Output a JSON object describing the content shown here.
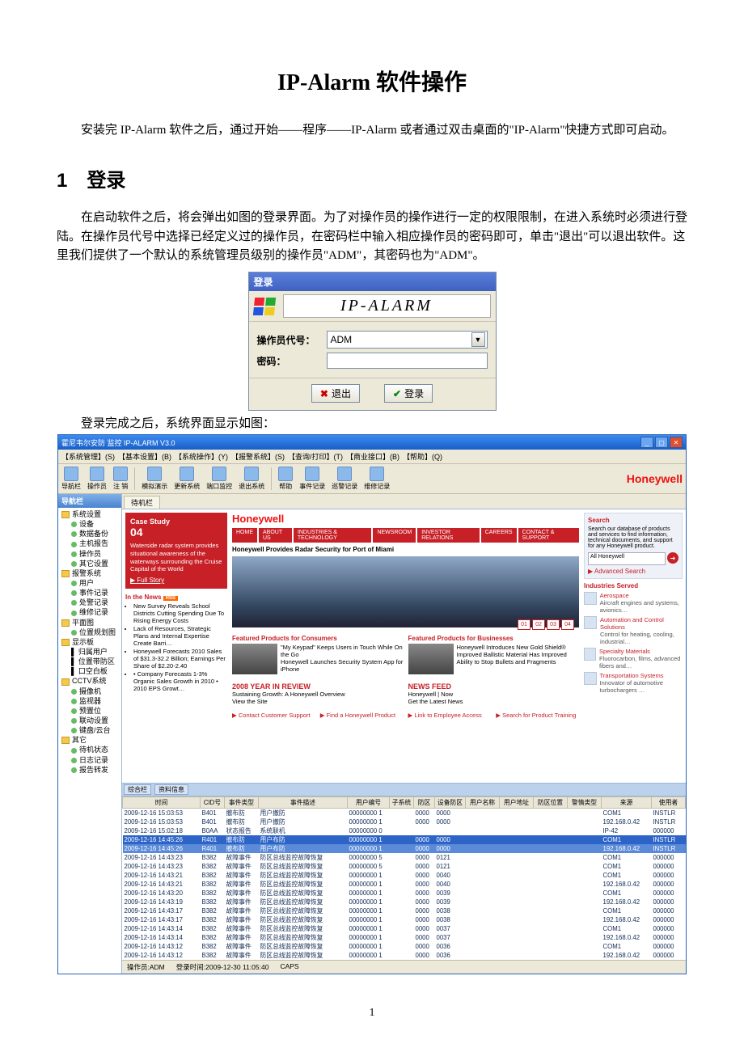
{
  "doc": {
    "title": "IP-Alarm 软件操作",
    "intro": "安装完 IP-Alarm 软件之后，通过开始——程序——IP-Alarm 或者通过双击桌面的\"IP-Alarm\"快捷方式即可启动。",
    "section1_heading": "1　登录",
    "section1_body": "在启动软件之后，将会弹出如图的登录界面。为了对操作员的操作进行一定的权限限制，在进入系统时必须进行登陆。在操作员代号中选择已经定义过的操作员，在密码栏中输入相应操作员的密码即可，单击\"退出\"可以退出软件。这里我们提供了一个默认的系统管理员级别的操作员\"ADM\"，其密码也为\"ADM\"。",
    "caption_after_login": "登录完成之后，系统界面显示如图：",
    "page_number": "1"
  },
  "login": {
    "title": "登录",
    "brand": "IP-ALARM",
    "operator_label": "操作员代号：",
    "operator_value": "ADM",
    "password_label": "密码：",
    "exit_btn": "退出",
    "login_btn": "登录"
  },
  "app": {
    "title": "霍尼韦尔安防 监控  IP-ALARM V3.0",
    "menus": [
      "【系统管理】(S)",
      "【基本设置】(B)",
      "【系统操作】(Y)",
      "【报警系统】(S)",
      "【查询/打印】(T)",
      "【商业接口】(B)",
      "【帮助】(Q)"
    ],
    "toolbar": [
      "导航栏",
      "操作员",
      "注 销",
      "模拟演示",
      "更新系统",
      "端口监控",
      "退出系统",
      "帮助",
      "事件记录",
      "巡警记录",
      "维修记录"
    ],
    "brand": "Honeywell",
    "side_title": "导航栏",
    "tree": [
      {
        "d": 0,
        "cls": "open ico-y",
        "t": "系统设置"
      },
      {
        "d": 1,
        "cls": "ico-g",
        "t": "设备"
      },
      {
        "d": 1,
        "cls": "ico-g",
        "t": "数据备份"
      },
      {
        "d": 1,
        "cls": "ico-g",
        "t": "主机报告"
      },
      {
        "d": 1,
        "cls": "ico-g",
        "t": "操作员"
      },
      {
        "d": 1,
        "cls": "ico-g",
        "t": "其它设置"
      },
      {
        "d": 0,
        "cls": "open ico-y",
        "t": "报警系统"
      },
      {
        "d": 1,
        "cls": "ico-g",
        "t": "用户"
      },
      {
        "d": 1,
        "cls": "ico-g",
        "t": "事件记录"
      },
      {
        "d": 1,
        "cls": "ico-g",
        "t": "处警记录"
      },
      {
        "d": 1,
        "cls": "ico-g",
        "t": "维修记录"
      },
      {
        "d": 0,
        "cls": "open ico-y",
        "t": "平面图"
      },
      {
        "d": 1,
        "cls": "ico-g",
        "t": "位置规划图"
      },
      {
        "d": 0,
        "cls": "open ico-y",
        "t": "显示板"
      },
      {
        "d": 1,
        "cls": "",
        "t": "▌ 归属用户"
      },
      {
        "d": 1,
        "cls": "",
        "t": "▌ 位置带防区"
      },
      {
        "d": 1,
        "cls": "",
        "t": "▌ 口空白板"
      },
      {
        "d": 0,
        "cls": "open ico-y",
        "t": "CCTV系统"
      },
      {
        "d": 1,
        "cls": "ico-g",
        "t": "摄像机"
      },
      {
        "d": 1,
        "cls": "ico-g",
        "t": "监视器"
      },
      {
        "d": 1,
        "cls": "ico-g",
        "t": "预置位"
      },
      {
        "d": 1,
        "cls": "ico-g",
        "t": "联动设置"
      },
      {
        "d": 1,
        "cls": "ico-g",
        "t": "键盘/云台"
      },
      {
        "d": 0,
        "cls": "open ico-y",
        "t": "其它"
      },
      {
        "d": 1,
        "cls": "ico-g",
        "t": "待机状态"
      },
      {
        "d": 1,
        "cls": "ico-g",
        "t": "日志记录"
      },
      {
        "d": 1,
        "cls": "ico-g",
        "t": "报告转发"
      }
    ],
    "tab_label": "待机栏",
    "web": {
      "brand": "Honeywell",
      "nav": [
        "HOME",
        "ABOUT US",
        "INDUSTRIES & TECHNOLOGY",
        "NEWSROOM",
        "INVESTOR RELATIONS",
        "CAREERS",
        "CONTACT & SUPPORT"
      ],
      "case_title": "Case Study",
      "case_no": "04",
      "case_body": "Waterside radar system provides situational awareness of the waterways surrounding the Cruise Capital of the World",
      "case_link": "▶ Full Story",
      "hero_head": "Honeywell Provides Radar Security for Port of Miami",
      "pager": [
        "01",
        "02",
        "03",
        "04"
      ],
      "in_news": "In the News",
      "rss": "RSS",
      "news_items": [
        "New Survey Reveals School Districts Cutting Spending Due To Rising Energy Costs",
        "Lack of Resources, Strategic Plans and Internal Expertise Create Barri…",
        "Honeywell Forecasts 2010 Sales of $31.3-32.2 Billion; Earnings Per Share of $2.20-2.40",
        "• Company Forecasts 1-3% Organic Sales Growth in 2010 • 2010 EPS Growt…"
      ],
      "feat_cons": "Featured Products for Consumers",
      "cons_items": [
        "\"My Keypad\" Keeps Users in Touch While On the Go",
        "Honeywell Launches Security System App for iPhone"
      ],
      "feat_biz": "Featured Products for Businesses",
      "biz_items": [
        "Honeywell Introduces New Gold Shield®",
        "Improved Ballistic Material Has Improved Ability to Stop Bullets and Fragments"
      ],
      "yr": "2008 YEAR IN REVIEW",
      "yr_items": [
        "Sustaining Growth: A Honeywell Overview",
        "View the Site"
      ],
      "feed": "NEWS FEED",
      "feed_items": [
        "Honeywell | Now",
        "Get the Latest News"
      ],
      "links": [
        "▶ Contact Customer Support",
        "▶ Find a Honeywell Product",
        "▶ Link to Employee Access",
        "▶ Search for Product Training"
      ],
      "search_h": "Search",
      "search_body": "Search our database of products and services to find information, technical documents, and support for any Honeywell product.",
      "search_field": "All Honeywell",
      "adv": "▶ Advanced Search",
      "ind_h": "Industries Served",
      "ind": [
        {
          "n": "Aerospace",
          "d": "Aircraft engines and systems, avionics…"
        },
        {
          "n": "Automation and Control Solutions",
          "d": "Control for heating, cooling, industrial…"
        },
        {
          "n": "Specialty Materials",
          "d": "Fluorocarbon, films, advanced fibers and…"
        },
        {
          "n": "Transportation Systems",
          "d": "Innovator of automotive turbochargers …"
        }
      ]
    },
    "bottom_tabs": [
      "综合栏",
      "资料信息"
    ],
    "grid": {
      "headers": [
        "时间",
        "CID号",
        "事件类型",
        "事件描述",
        "用户编号",
        "子系统",
        "防区",
        "设备防区",
        "用户名称",
        "用户地址",
        "防区位置",
        "警情类型",
        "来源",
        "使用者"
      ],
      "widths": [
        96,
        30,
        42,
        110,
        52,
        30,
        26,
        38,
        42,
        42,
        42,
        42,
        62,
        42
      ],
      "rows": [
        [
          "2009-12-16 15:03:53",
          "B401",
          "撤布防",
          "用户撤防",
          "00000000 1",
          "",
          "0000",
          "0000",
          "",
          "",
          "",
          "",
          "COM1",
          "INSTLR"
        ],
        [
          "2009-12-16 15:03:53",
          "B401",
          "撤布防",
          "用户撤防",
          "00000000 1",
          "",
          "0000",
          "0000",
          "",
          "",
          "",
          "",
          "192.168.0.42",
          "INSTLR"
        ],
        [
          "2009-12-16 15:02:18",
          "B0AA",
          "状态报告",
          "系统联机",
          "00000000 0",
          "",
          "",
          "",
          "",
          "",
          "",
          "",
          "IP-42",
          "000000"
        ],
        [
          "2009-12-16 14:45:26",
          "R401",
          "撤布防",
          "用户布防",
          "00000000 1",
          "",
          "0000",
          "0000",
          "",
          "",
          "",
          "",
          "COM1",
          "INSTLR"
        ],
        [
          "2009-12-16 14:45:26",
          "R401",
          "撤布防",
          "用户布防",
          "00000000 1",
          "",
          "0000",
          "0000",
          "",
          "",
          "",
          "",
          "192.168.0.42",
          "INSTLR"
        ],
        [
          "2009-12-16 14:43:23",
          "B382",
          "故障事件",
          "防区总线监控故障恢复",
          "00000000 5",
          "",
          "0000",
          "0121",
          "",
          "",
          "",
          "",
          "COM1",
          "000000"
        ],
        [
          "2009-12-16 14:43:23",
          "B382",
          "故障事件",
          "防区总线监控故障恢复",
          "00000000 5",
          "",
          "0000",
          "0121",
          "",
          "",
          "",
          "",
          "COM1",
          "000000"
        ],
        [
          "2009-12-16 14:43:21",
          "B382",
          "故障事件",
          "防区总线监控故障恢复",
          "00000000 1",
          "",
          "0000",
          "0040",
          "",
          "",
          "",
          "",
          "COM1",
          "000000"
        ],
        [
          "2009-12-16 14:43:21",
          "B382",
          "故障事件",
          "防区总线监控故障恢复",
          "00000000 1",
          "",
          "0000",
          "0040",
          "",
          "",
          "",
          "",
          "192.168.0.42",
          "000000"
        ],
        [
          "2009-12-16 14:43:20",
          "B382",
          "故障事件",
          "防区总线监控故障恢复",
          "00000000 1",
          "",
          "0000",
          "0039",
          "",
          "",
          "",
          "",
          "COM1",
          "000000"
        ],
        [
          "2009-12-16 14:43:19",
          "B382",
          "故障事件",
          "防区总线监控故障恢复",
          "00000000 1",
          "",
          "0000",
          "0039",
          "",
          "",
          "",
          "",
          "192.168.0.42",
          "000000"
        ],
        [
          "2009-12-16 14:43:17",
          "B382",
          "故障事件",
          "防区总线监控故障恢复",
          "00000000 1",
          "",
          "0000",
          "0038",
          "",
          "",
          "",
          "",
          "COM1",
          "000000"
        ],
        [
          "2009-12-16 14:43:17",
          "B382",
          "故障事件",
          "防区总线监控故障恢复",
          "00000000 1",
          "",
          "0000",
          "0038",
          "",
          "",
          "",
          "",
          "192.168.0.42",
          "000000"
        ],
        [
          "2009-12-16 14:43:14",
          "B382",
          "故障事件",
          "防区总线监控故障恢复",
          "00000000 1",
          "",
          "0000",
          "0037",
          "",
          "",
          "",
          "",
          "COM1",
          "000000"
        ],
        [
          "2009-12-16 14:43:14",
          "B382",
          "故障事件",
          "防区总线监控故障恢复",
          "00000000 1",
          "",
          "0000",
          "0037",
          "",
          "",
          "",
          "",
          "192.168.0.42",
          "000000"
        ],
        [
          "2009-12-16 14:43:12",
          "B382",
          "故障事件",
          "防区总线监控故障恢复",
          "00000000 1",
          "",
          "0000",
          "0036",
          "",
          "",
          "",
          "",
          "COM1",
          "000000"
        ],
        [
          "2009-12-16 14:43:12",
          "B382",
          "故障事件",
          "防区总线监控故障恢复",
          "00000000 1",
          "",
          "0000",
          "0036",
          "",
          "",
          "",
          "",
          "192.168.0.42",
          "000000"
        ]
      ],
      "sel": [
        3,
        4
      ]
    },
    "status": {
      "op_label": "操作员:",
      "op": "ADM",
      "login_label": "登录时间:",
      "login": "2009-12-30 11:05:40",
      "caps": "CAPS"
    }
  }
}
